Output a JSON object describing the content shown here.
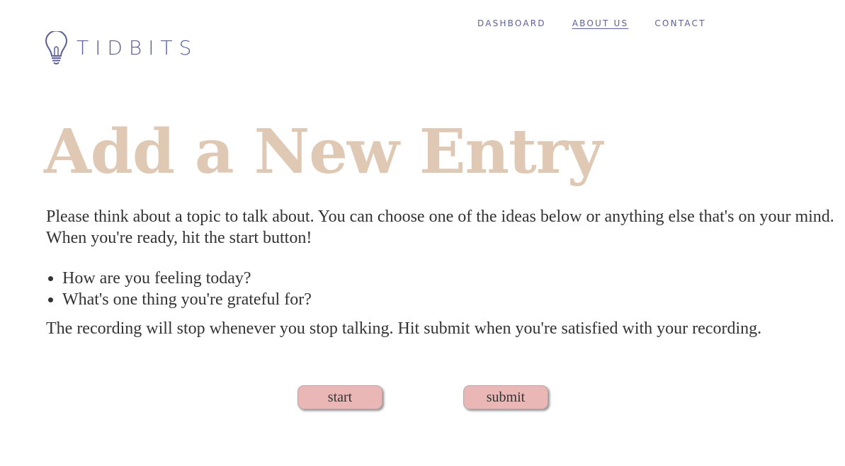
{
  "brand": {
    "name": "TIDBITS",
    "logo_icon": "lightbulb-icon",
    "color": "#5b5f9a"
  },
  "nav": {
    "items": [
      {
        "label": "DASHBOARD",
        "active": false
      },
      {
        "label": "ABOUT US",
        "active": true
      },
      {
        "label": "CONTACT",
        "active": false
      }
    ]
  },
  "main": {
    "title": "Add a New Entry",
    "title_color": "#dfc9b4",
    "intro": "Please think about a topic to talk about. You can choose one of the ideas below or anything else that's on your mind. When you're ready, hit the start button!",
    "ideas": [
      "How are you feeling today?",
      "What's one thing you're grateful for?"
    ],
    "note": "The recording will stop whenever you stop talking. Hit submit when you're satisfied with your recording."
  },
  "actions": {
    "start_label": "start",
    "submit_label": "submit",
    "button_color": "#ebb7b6"
  }
}
